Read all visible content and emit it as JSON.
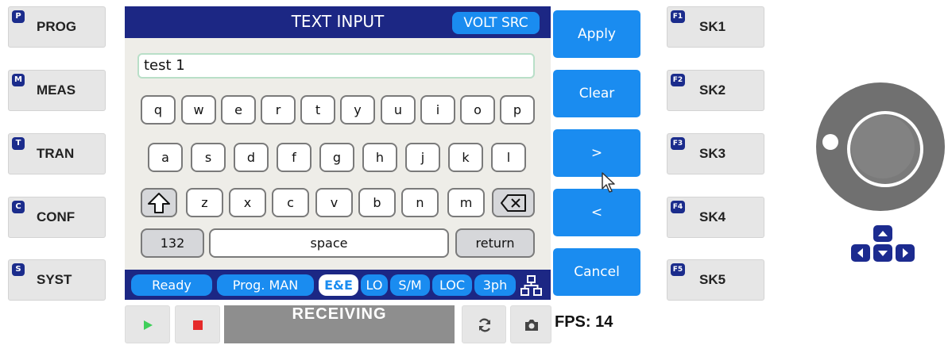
{
  "hard_keys": [
    {
      "badge": "P",
      "label": "PROG"
    },
    {
      "badge": "M",
      "label": "MEAS"
    },
    {
      "badge": "T",
      "label": "TRAN"
    },
    {
      "badge": "C",
      "label": "CONF"
    },
    {
      "badge": "S",
      "label": "SYST"
    }
  ],
  "soft_keys": [
    {
      "badge": "F1",
      "label": "SK1"
    },
    {
      "badge": "F2",
      "label": "SK2"
    },
    {
      "badge": "F3",
      "label": "SK3"
    },
    {
      "badge": "F4",
      "label": "SK4"
    },
    {
      "badge": "F5",
      "label": "SK5"
    }
  ],
  "screen": {
    "title": "TEXT INPUT",
    "mode_badge": "VOLT SRC",
    "input_value": "test 1"
  },
  "keyboard": {
    "row1": [
      "q",
      "w",
      "e",
      "r",
      "t",
      "y",
      "u",
      "i",
      "o",
      "p"
    ],
    "row2": [
      "a",
      "s",
      "d",
      "f",
      "g",
      "h",
      "j",
      "k",
      "l"
    ],
    "row3": [
      "z",
      "x",
      "c",
      "v",
      "b",
      "n",
      "m"
    ],
    "numeric_key": "132",
    "space_key": "space",
    "return_key": "return"
  },
  "status": {
    "ready": "Ready",
    "prog": "Prog. MAN",
    "ee": "E&E",
    "lo": "LO",
    "sm": "S/M",
    "loc": "LOC",
    "phase": "3ph"
  },
  "actions": {
    "apply": "Apply",
    "clear": "Clear",
    "next": ">",
    "prev": "<",
    "cancel": "Cancel"
  },
  "bottom": {
    "receiving": "RECEIVING",
    "fps": "FPS: 14"
  },
  "colors": {
    "screen_header": "#1c2784",
    "accent_blue": "#1a8cf0",
    "badge": "#1b2c8c",
    "knob": "#707070"
  }
}
